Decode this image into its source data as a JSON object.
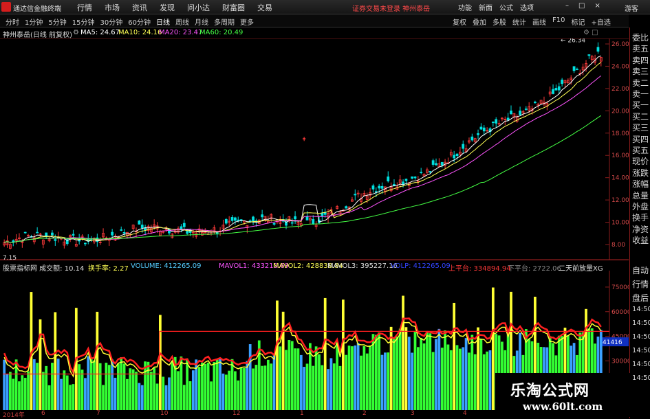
{
  "menubar": {
    "app_name": "通达信金融终端",
    "menus": [
      "行情",
      "市场",
      "资讯",
      "发现",
      "问小达",
      "财富圈",
      "交易"
    ],
    "warning": "证券交易未登录  神州泰岳",
    "right_menus": [
      "功能",
      "新面",
      "公式",
      "选项"
    ],
    "guest": "游客"
  },
  "toolbar": {
    "periods": [
      "分时",
      "1分钟",
      "5分钟",
      "15分钟",
      "30分钟",
      "60分钟",
      "日线",
      "周线",
      "月线",
      "多周期",
      "更多"
    ],
    "active_period": "日线",
    "tools": [
      "复权",
      "叠加",
      "多股",
      "统计",
      "画线",
      "F10",
      "标记",
      "+自选"
    ]
  },
  "info": {
    "stock": "神州泰岳(日线 前复权)",
    "ma5": "MA5: 24.67",
    "ma10": "MA10: 24.16",
    "ma20": "MA20: 23.47",
    "ma60": "MA60: 20.49"
  },
  "price_axis": {
    "ticks": [
      "26.00",
      "24.00",
      "22.00",
      "20.00",
      "18.00",
      "16.00",
      "14.00",
      "12.00",
      "10.00",
      "8.00"
    ],
    "high_label": "26.34",
    "low_label": "7.15"
  },
  "volume_info": {
    "title": "股票指标网 成交额: 10.14",
    "turnover": "换手率: 2.27",
    "volume": "VOLUME: 412265.09",
    "mavol1": "MAVOL1: 433210.69",
    "mavol2": "MAVOL2: 428838.84",
    "mavol3": "MAVOL3: 395227.16",
    "volp": "VOLP: 412265.09",
    "upper": "上平台: 334894.94",
    "lower": "下平台: 2722.06",
    "tail": "二天前放量XG"
  },
  "volume_axis": {
    "ticks": [
      "75000",
      "60000",
      "45000",
      "30000"
    ],
    "current_label": "41416"
  },
  "right_panel": {
    "top": [
      "委比",
      "卖五",
      "卖四",
      "卖三",
      "卖二",
      "卖一",
      "买一",
      "买二",
      "买三",
      "买四",
      "买五",
      "现价",
      "涨跌",
      "涨幅",
      "总量",
      "外盘",
      "换手",
      "净资",
      "收益"
    ],
    "bottom": [
      "自动",
      "行情",
      "盘后",
      "14:50",
      "14:50",
      "14:50",
      "14:50",
      "14:50",
      "14:50"
    ]
  },
  "xaxis": {
    "labels": [
      "2014年",
      "6",
      "7",
      "10",
      "12",
      "1",
      "2",
      "3",
      "4"
    ]
  },
  "watermark": {
    "title": "乐淘公式网",
    "url": "www.60lt.com"
  },
  "colors": {
    "up": "#ff3a3a",
    "down": "#00e0e0",
    "ma5": "#ffffff",
    "ma10": "#ffff55",
    "ma20": "#ff55ff",
    "ma60": "#44ff44",
    "axis": "#8b1c1c"
  }
}
